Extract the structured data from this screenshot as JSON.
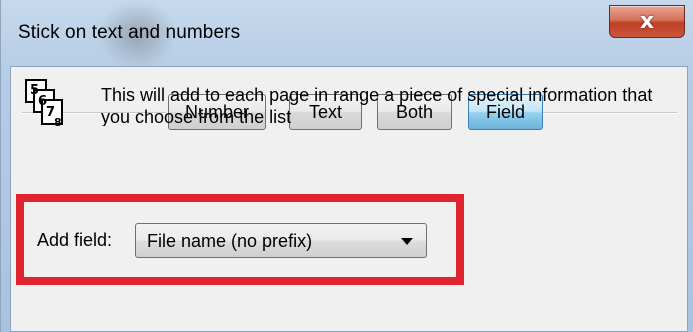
{
  "window": {
    "title": "Stick on text and numbers",
    "close_glyph": "x"
  },
  "mode_tabs": [
    {
      "label": "Number",
      "active": false
    },
    {
      "label": "Text",
      "active": false
    },
    {
      "label": "Both",
      "active": false
    },
    {
      "label": "Field",
      "active": true
    }
  ],
  "description": "This will add to each page in range a piece of special information that you choose from the list",
  "add_field": {
    "label": "Add field:",
    "selected": "File name (no prefix)"
  },
  "icons": {
    "app_icon": "stacked-pages-numbers-icon",
    "dropdown_icon": "chevron-down-icon",
    "close_icon": "close-icon"
  },
  "colors": {
    "highlight": "#e0242f",
    "close_button": "#c13f26",
    "active_tab": "#68b3db"
  }
}
